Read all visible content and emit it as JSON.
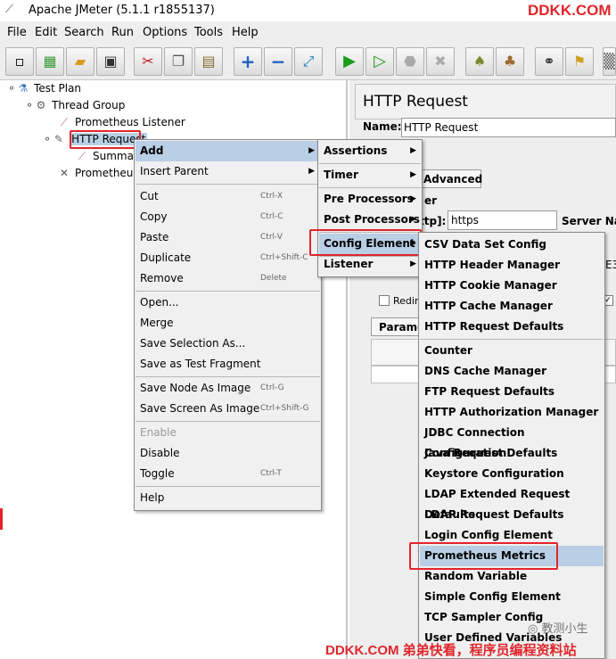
{
  "window": {
    "title": "Apache JMeter (5.1.1 r1855137)",
    "watermark": "DDKK.COM"
  },
  "menubar": [
    "File",
    "Edit",
    "Search",
    "Run",
    "Options",
    "Tools",
    "Help"
  ],
  "toolbar_icons": [
    "new-icon",
    "templates-icon",
    "open-icon",
    "save-icon",
    "cut-icon",
    "copy-icon",
    "paste-icon",
    "expand-icon",
    "collapse-icon",
    "toggle-icon",
    "start-icon",
    "start-no-pause-icon",
    "stop-icon",
    "shutdown-icon",
    "clear-icon",
    "clear-all-icon",
    "search-icon",
    "reset-search-icon",
    "function-helper-icon"
  ],
  "tree": {
    "nodes": [
      {
        "label": "Test Plan"
      },
      {
        "label": "Thread Group"
      },
      {
        "label": "Prometheus Listener"
      },
      {
        "label": "HTTP Request"
      },
      {
        "label": "Summa"
      },
      {
        "label": "Prometheu"
      }
    ]
  },
  "right_panel": {
    "title": "HTTP Request",
    "name_label": "Name:",
    "name_value": "HTTP Request",
    "tab_advanced": "Advanced",
    "group_label": "er",
    "protocol_label": "ttp]:",
    "protocol_value": "https",
    "server_label": "Server Nar",
    "redirect_label": "Redire",
    "params_tab": "Parame",
    "e3": "E3"
  },
  "context_menu": {
    "items": [
      {
        "label": "Add",
        "submenu": true
      },
      {
        "label": "Insert Parent",
        "submenu": true
      },
      {
        "label": "Cut",
        "shortcut": "Ctrl-X"
      },
      {
        "label": "Copy",
        "shortcut": "Ctrl-C"
      },
      {
        "label": "Paste",
        "shortcut": "Ctrl-V"
      },
      {
        "label": "Duplicate",
        "shortcut": "Ctrl+Shift-C"
      },
      {
        "label": "Remove",
        "shortcut": "Delete"
      },
      {
        "label": "Open..."
      },
      {
        "label": "Merge"
      },
      {
        "label": "Save Selection As..."
      },
      {
        "label": "Save as Test Fragment"
      },
      {
        "label": "Save Node As Image",
        "shortcut": "Ctrl-G"
      },
      {
        "label": "Save Screen As Image",
        "shortcut": "Ctrl+Shift-G"
      },
      {
        "label": "Enable"
      },
      {
        "label": "Disable"
      },
      {
        "label": "Toggle",
        "shortcut": "Ctrl-T"
      },
      {
        "label": "Help"
      }
    ]
  },
  "add_submenu": [
    "Assertions",
    "Timer",
    "Pre Processors",
    "Post Processors",
    "Config Element",
    "Listener"
  ],
  "config_submenu": [
    "CSV Data Set Config",
    "HTTP Header Manager",
    "HTTP Cookie Manager",
    "HTTP Cache Manager",
    "HTTP Request Defaults",
    "Counter",
    "DNS Cache Manager",
    "FTP Request Defaults",
    "HTTP Authorization Manager",
    "JDBC Connection Configuration",
    "Java Request Defaults",
    "Keystore Configuration",
    "LDAP Extended Request Defaults",
    "LDAP Request Defaults",
    "Login Config Element",
    "Prometheus Metrics",
    "Random Variable",
    "Simple Config Element",
    "TCP Sampler Config",
    "User Defined Variables"
  ],
  "overlay": {
    "bottom_watermark": "DDKK.COM 弟弟快看，程序员编程资料站",
    "wechat_label": "教测小生"
  },
  "colors": {
    "highlight": "#b8cfe5",
    "annotation": "#e0262b"
  }
}
